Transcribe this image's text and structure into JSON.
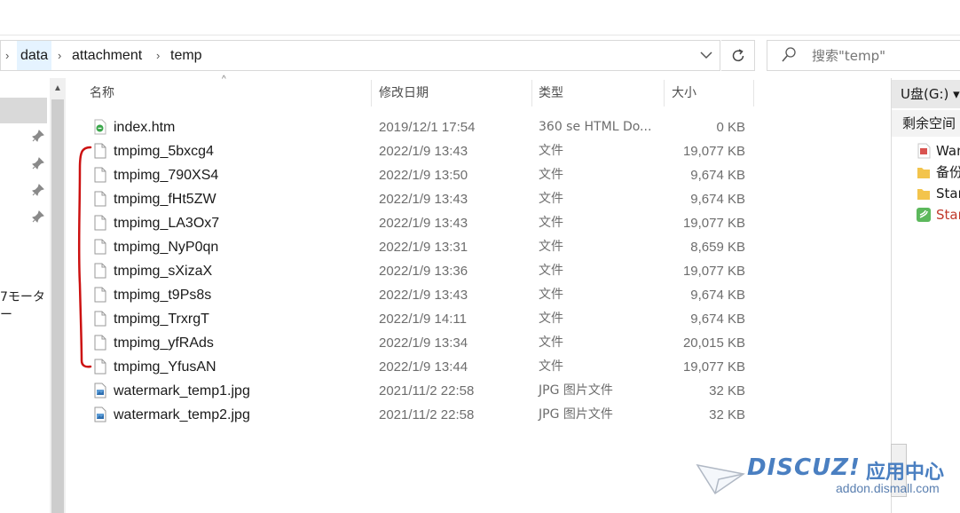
{
  "address_bar": {
    "segments": [
      "data",
      "attachment",
      "temp"
    ],
    "dropdown_icon": "chevron-down-icon",
    "refresh_icon": "refresh-icon"
  },
  "search": {
    "placeholder": "搜索\"temp\""
  },
  "nav_pane": {
    "partial_label": "7モーター"
  },
  "columns": {
    "name": "名称",
    "date": "修改日期",
    "type": "类型",
    "size": "大小"
  },
  "files": [
    {
      "name": "index.htm",
      "date": "2019/12/1 17:54",
      "type": "360 se HTML Do...",
      "size": "0 KB",
      "icon": "html-file-icon"
    },
    {
      "name": "tmpimg_5bxcg4",
      "date": "2022/1/9 13:43",
      "type": "文件",
      "size": "19,077 KB",
      "icon": "file-icon"
    },
    {
      "name": "tmpimg_790XS4",
      "date": "2022/1/9 13:50",
      "type": "文件",
      "size": "9,674 KB",
      "icon": "file-icon"
    },
    {
      "name": "tmpimg_fHt5ZW",
      "date": "2022/1/9 13:43",
      "type": "文件",
      "size": "9,674 KB",
      "icon": "file-icon"
    },
    {
      "name": "tmpimg_LA3Ox7",
      "date": "2022/1/9 13:43",
      "type": "文件",
      "size": "19,077 KB",
      "icon": "file-icon"
    },
    {
      "name": "tmpimg_NyP0qn",
      "date": "2022/1/9 13:31",
      "type": "文件",
      "size": "8,659 KB",
      "icon": "file-icon"
    },
    {
      "name": "tmpimg_sXizaX",
      "date": "2022/1/9 13:36",
      "type": "文件",
      "size": "19,077 KB",
      "icon": "file-icon"
    },
    {
      "name": "tmpimg_t9Ps8s",
      "date": "2022/1/9 13:43",
      "type": "文件",
      "size": "9,674 KB",
      "icon": "file-icon"
    },
    {
      "name": "tmpimg_TrxrgT",
      "date": "2022/1/9 14:11",
      "type": "文件",
      "size": "9,674 KB",
      "icon": "file-icon"
    },
    {
      "name": "tmpimg_yfRAds",
      "date": "2022/1/9 13:34",
      "type": "文件",
      "size": "20,015 KB",
      "icon": "file-icon"
    },
    {
      "name": "tmpimg_YfusAN",
      "date": "2022/1/9 13:44",
      "type": "文件",
      "size": "19,077 KB",
      "icon": "file-icon"
    },
    {
      "name": "watermark_temp1.jpg",
      "date": "2021/11/2 22:58",
      "type": "JPG 图片文件",
      "size": "32 KB",
      "icon": "image-file-icon"
    },
    {
      "name": "watermark_temp2.jpg",
      "date": "2021/11/2 22:58",
      "type": "JPG 图片文件",
      "size": "32 KB",
      "icon": "image-file-icon"
    }
  ],
  "right_pane": {
    "drive": "U盘(G:) ▾",
    "free_space": "剩余空间",
    "items": [
      {
        "label": "Wan",
        "icon": "pdf-file-icon"
      },
      {
        "label": "备份",
        "icon": "folder-icon"
      },
      {
        "label": "Star",
        "icon": "folder-icon"
      },
      {
        "label": "Star",
        "icon": "seagate-app-icon"
      }
    ]
  },
  "watermark": {
    "brand": "DISCUZ!",
    "brand_cn": "应用中心",
    "domain": "addon.dismall.com"
  },
  "colors": {
    "annotation_red": "#cc1111",
    "selection_blue": "#e5f3ff",
    "secondary_text": "#6d6d6d"
  }
}
